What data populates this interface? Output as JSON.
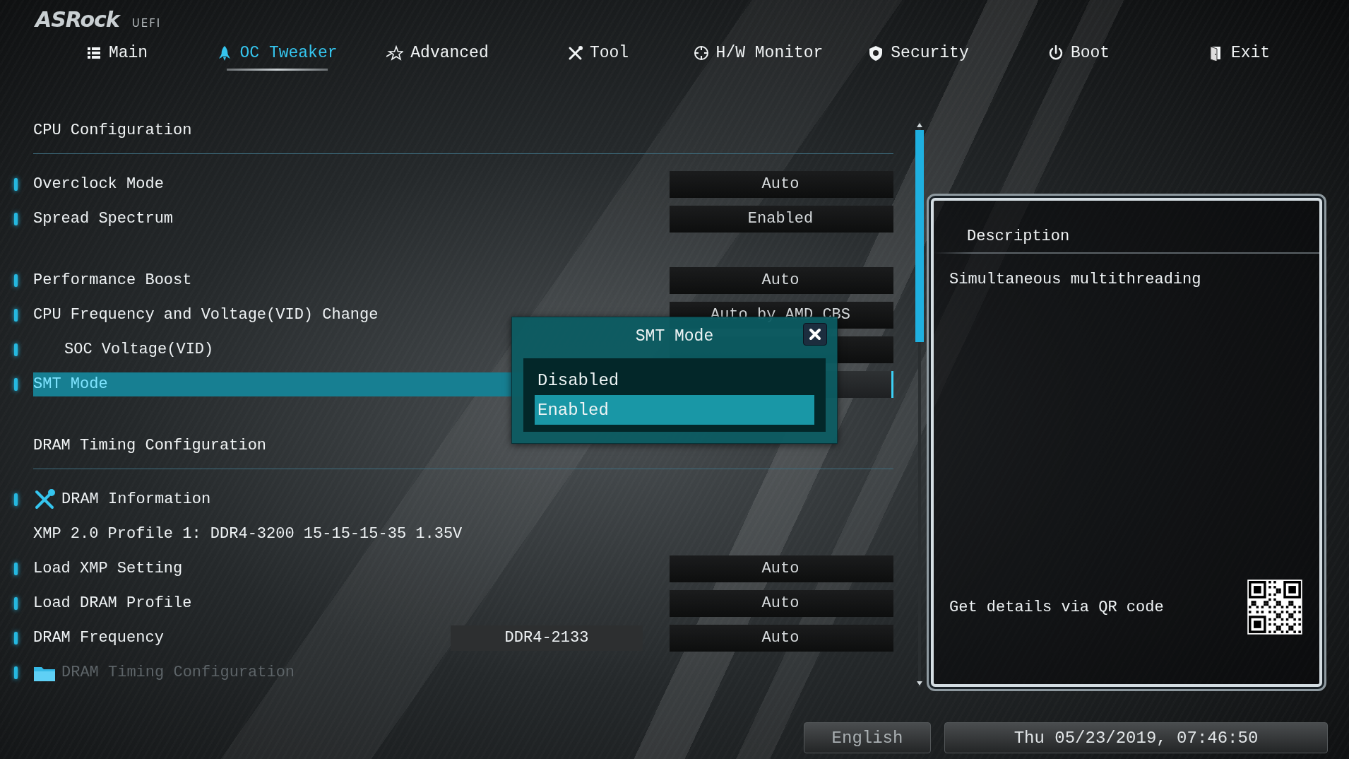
{
  "logo": {
    "brand": "ASRock",
    "suffix": "UEFI"
  },
  "tabs": [
    {
      "label": "Main",
      "selected": false
    },
    {
      "label": "OC Tweaker",
      "selected": true
    },
    {
      "label": "Advanced",
      "selected": false
    },
    {
      "label": "Tool",
      "selected": false
    },
    {
      "label": "H/W Monitor",
      "selected": false
    },
    {
      "label": "Security",
      "selected": false
    },
    {
      "label": "Boot",
      "selected": false
    },
    {
      "label": "Exit",
      "selected": false
    }
  ],
  "sections": [
    {
      "title": "CPU Configuration",
      "groups": [
        [
          {
            "kind": "setting",
            "label": "Overclock Mode",
            "value": "Auto",
            "selected": false,
            "disabled": false
          },
          {
            "kind": "setting",
            "label": "Spread Spectrum",
            "value": "Enabled",
            "selected": false,
            "disabled": false
          }
        ],
        [
          {
            "kind": "setting",
            "label": "Performance Boost",
            "value": "Auto",
            "selected": false,
            "disabled": false
          },
          {
            "kind": "setting",
            "label": "CPU Frequency and Voltage(VID) Change",
            "value": "Auto by AMD CBS",
            "selected": false,
            "disabled": false,
            "children": [
              {
                "kind": "setting",
                "label": "SOC Voltage(VID)",
                "selected": false,
                "disabled": false
              }
            ]
          },
          {
            "kind": "setting",
            "label": "SMT Mode",
            "selected": true,
            "disabled": false
          }
        ]
      ]
    },
    {
      "title": "DRAM Timing Configuration",
      "groups": [
        [
          {
            "kind": "tool",
            "label": "DRAM Information",
            "selected": false,
            "disabled": false
          },
          {
            "kind": "info",
            "label": "XMP 2.0 Profile 1: DDR4-3200 15-15-15-35 1.35V",
            "selected": false,
            "disabled": false
          },
          {
            "kind": "setting",
            "label": "Load XMP Setting",
            "value": "Auto",
            "selected": false,
            "disabled": false
          },
          {
            "kind": "setting",
            "label": "Load DRAM Profile",
            "value": "Auto",
            "selected": false,
            "disabled": false
          },
          {
            "kind": "setting",
            "label": "DRAM Frequency",
            "current": "DDR4-2133",
            "value": "Auto",
            "selected": false,
            "disabled": false
          },
          {
            "kind": "folder",
            "label": "DRAM Timing Configuration",
            "selected": false,
            "disabled": true
          }
        ]
      ]
    }
  ],
  "description": {
    "title": "Description",
    "text": "Simultaneous multithreading",
    "qr_hint": "Get details via QR code"
  },
  "popup": {
    "title": "SMT Mode",
    "options": [
      {
        "label": "Disabled",
        "selected": false
      },
      {
        "label": "Enabled",
        "selected": true
      }
    ]
  },
  "footer": {
    "language": "English",
    "datetime": "Thu 05/23/2019, 07:46:50"
  }
}
